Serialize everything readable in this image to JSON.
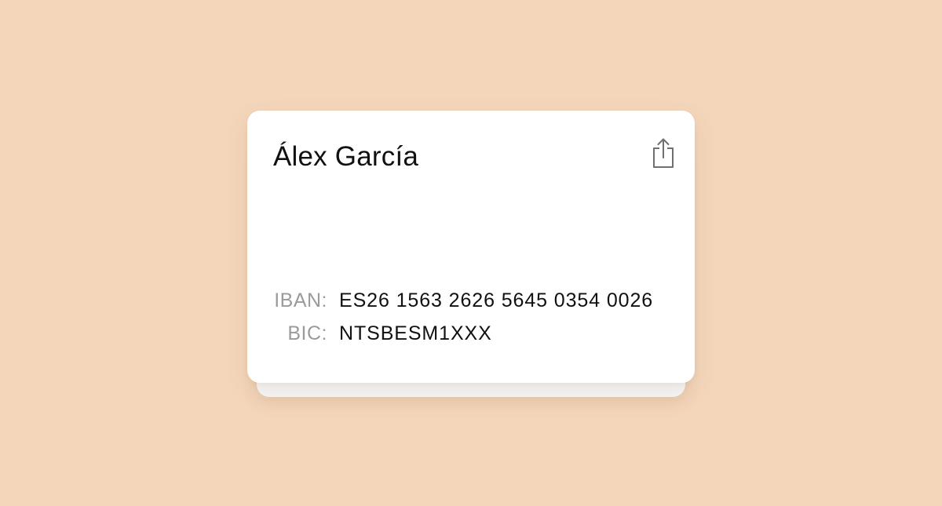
{
  "card": {
    "holder_name": "Álex García",
    "share_icon": "share-icon",
    "iban": {
      "label": "IBAN:",
      "value": "ES26 1563 2626 5645 0354 0026"
    },
    "bic": {
      "label": "BIC:",
      "value": "NTSBESM1XXX"
    }
  },
  "colors": {
    "background": "#f4d6bb",
    "card": "#ffffff",
    "label": "#9b9b9b",
    "text": "#111111"
  }
}
